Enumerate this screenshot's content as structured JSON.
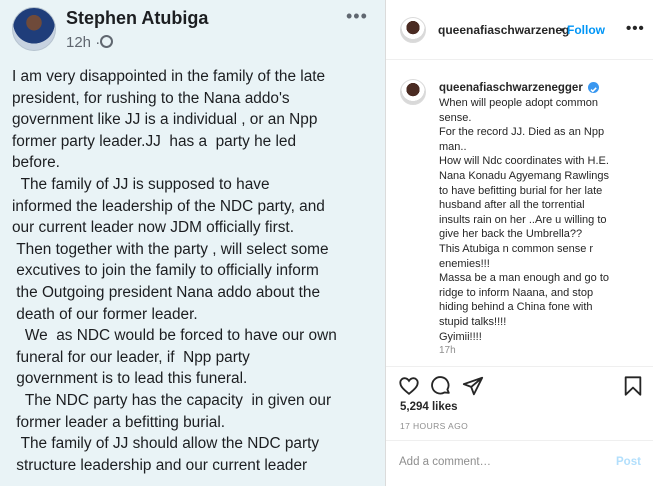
{
  "facebook": {
    "author": "Stephen Atubiga",
    "time": "12h ·",
    "body": "I am very disappointed in the family of the late\npresident, for rushing to the Nana addo's\ngovernment like JJ is a individual , or an Npp\nformer party leader.JJ  has a  party he led\nbefore.\n  The family of JJ is supposed to have\ninformed the leadership of the NDC party, and\nour current leader now JDM officially first.\n Then together with the party , will select some\n excutives to join the family to officially inform\n the Outgoing president Nana addo about the\n death of our former leader.\n   We  as NDC would be forced to have our own\n funeral for our leader, if  Npp party\n government is to lead this funeral.\n   The NDC party has the capacity  in given our\n former leader a befitting burial.\n  The family of JJ should allow the NDC party\n structure leadership and our current leader"
  },
  "instagram": {
    "header_username": "queenafiaschwarzeneg",
    "dot": "•",
    "follow_label": "Follow",
    "caption_username": "queenafiaschwarzenegger",
    "caption": "When will people adopt common\nsense.\nFor the record JJ. Died as an Npp\nman..\nHow will Ndc coordinates with H.E.\nNana Konadu Agyemang Rawlings\nto have befitting burial for her late\nhusband after all the torrential\ninsults rain on her ..Are u willing to\ngive her back the Umbrella??\nThis Atubiga n common sense r\nenemies!!!\nMassa be a man enough and go to\nridge to inform Naana, and stop\nhiding behind a China fone with\nstupid talks!!!!\nGyimii!!!!",
    "caption_time": "17h",
    "likes": "5,294 likes",
    "posted_ago": "17 HOURS AGO",
    "comment_placeholder": "Add a comment…",
    "post_label": "Post",
    "icons": [
      "heart-icon",
      "comment-icon",
      "share-icon",
      "bookmark-icon"
    ]
  }
}
